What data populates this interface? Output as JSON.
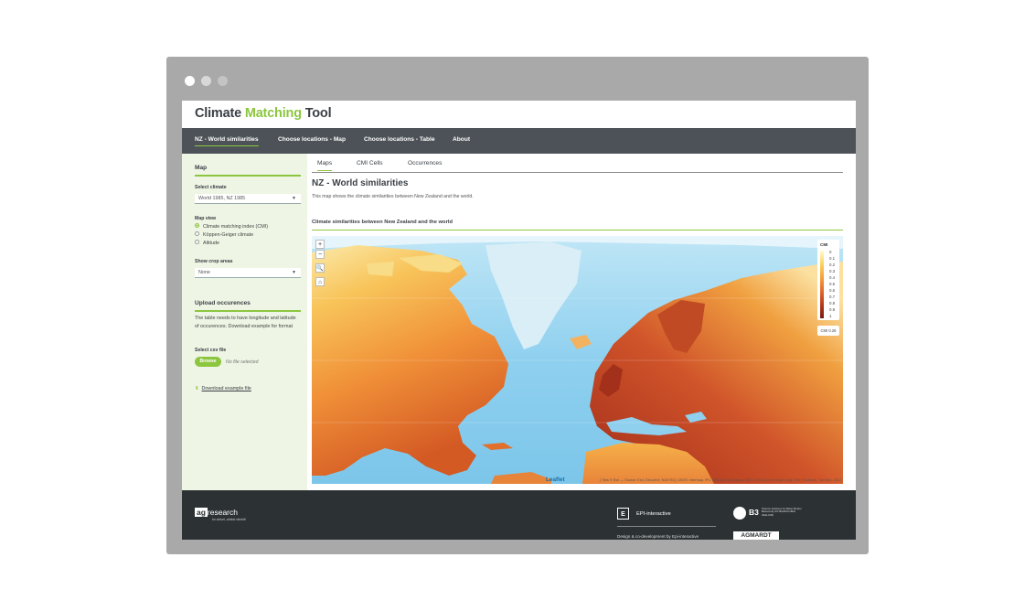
{
  "window": {
    "dots": [
      "#ffffff",
      "#d8d8d8",
      "#c4c4c4"
    ]
  },
  "app": {
    "title_part1": "Climate ",
    "title_part2": "Matching",
    "title_part3": " Tool",
    "accent_color": "#8cc63f"
  },
  "nav": {
    "items": [
      {
        "label": "NZ - World similarities",
        "active": true
      },
      {
        "label": "Choose locations - Map",
        "active": false
      },
      {
        "label": "Choose locations - Table",
        "active": false
      },
      {
        "label": "About",
        "active": false
      }
    ]
  },
  "sidebar": {
    "map_heading": "Map",
    "select_climate_label": "Select climate",
    "select_climate_value": "World 1985, NZ 1985",
    "map_view_label": "Map view",
    "map_view_options": [
      {
        "label": "Climate matching index (CMI)",
        "selected": true
      },
      {
        "label": "Köppen-Geiger climate",
        "selected": false
      },
      {
        "label": "Altitude",
        "selected": false
      }
    ],
    "crop_label": "Show crop areas",
    "crop_value": "None",
    "upload_heading": "Upload occurences",
    "upload_text": "The table needs to have longitude and latitude of occurences. Download example for format",
    "csv_label": "Select csv file",
    "browse_label": "Browse",
    "no_file_text": "No file selected",
    "download_label": "Download example file",
    "download_icon": "download-icon"
  },
  "main": {
    "tabs": [
      {
        "label": "Maps",
        "active": true
      },
      {
        "label": "CMI Cells",
        "active": false
      },
      {
        "label": "Occurrences",
        "active": false
      }
    ],
    "heading": "NZ - World similarities",
    "description": "This map shows the climate similarities between New Zealand and the world.",
    "section_heading": "Climate similarities between New Zealand and the world"
  },
  "map": {
    "zoom_in": "+",
    "zoom_out": "−",
    "search_icon": "magnifier-icon",
    "reset_icon": "home-icon",
    "legend_title": "CMI",
    "legend_ticks": [
      "0",
      "0.1",
      "0.2",
      "0.3",
      "0.4",
      "0.5",
      "0.6",
      "0.7",
      "0.8",
      "0.9",
      "1"
    ],
    "cmi_readout": "CMI 0.26",
    "leaflet_label": "Leaflet",
    "attribution": "| Tiles © Esri — Source: Esri, DeLorme, NAVTEQ, USGS, Intermap, iPC, NRCAN, Esri Japan, METI, Esri China (Hong Kong), Esri (Thailand), TomTom, 2012",
    "ocean_color": "#8fd0ef",
    "cmi_colors": [
      "#fffbd0",
      "#fbd35e",
      "#f5a03a",
      "#e06a2a",
      "#b63a1e",
      "#7a1a14"
    ]
  },
  "footer": {
    "agresearch_ag": "ag",
    "agresearch_rest": "research",
    "agresearch_tagline": "ko tahuri, ahikai rāwhiti",
    "epi_mark": "E",
    "epi_name": "EPI-interactive",
    "epi_credit": "Design & co-development by Epi-interactive",
    "b3_name": "B3",
    "b3_sub": "Science Solutions for Better Border Biosecurity AOTEAROA NEW ZEALAND",
    "agmardt": "AGMARDT"
  }
}
